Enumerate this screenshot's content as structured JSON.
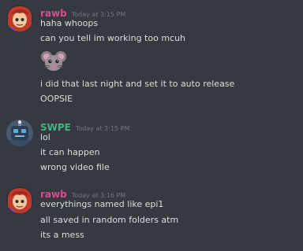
{
  "groups": [
    {
      "username": "rawb",
      "username_color": "#e0488f",
      "timestamp": "Today at 3:15 PM",
      "avatar_icon": "red-haired-character-avatar",
      "lines": [
        "haha whoops",
        "can you tell im working too mcuh"
      ],
      "emoji_icon": "rat-face-emoji",
      "lines_after_emoji": [
        "i did that last night and set it to auto release",
        "OOPSIE"
      ]
    },
    {
      "username": "SWPE",
      "username_color": "#43b581",
      "timestamp": "Today at 3:15 PM",
      "avatar_icon": "blue-robot-avatar",
      "lines": [
        "lol",
        "it can happen",
        "wrong video file"
      ]
    },
    {
      "username": "rawb",
      "username_color": "#e0488f",
      "timestamp": "Today at 3:16 PM",
      "avatar_icon": "red-haired-character-avatar",
      "lines": [
        "everythings named like epi1",
        "all saved in random folders atm",
        "its a mess"
      ]
    }
  ]
}
